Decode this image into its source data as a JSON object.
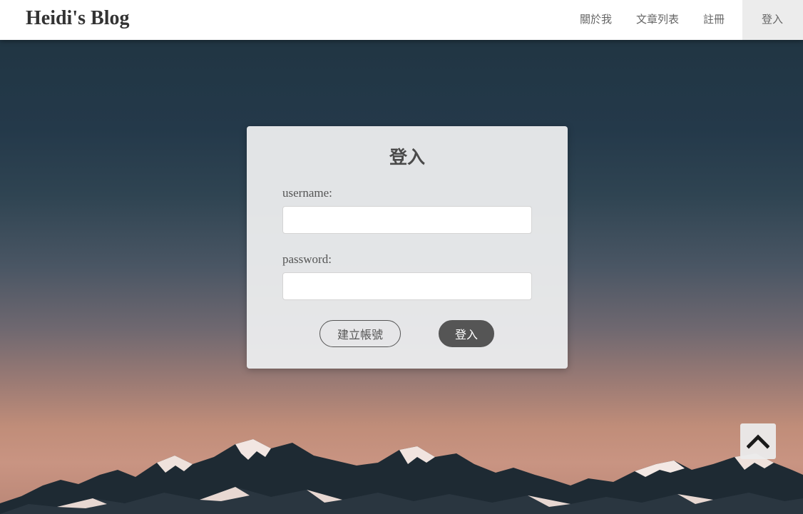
{
  "navbar": {
    "brand": "Heidi's Blog",
    "links": [
      {
        "label": "關於我"
      },
      {
        "label": "文章列表"
      },
      {
        "label": "註冊"
      },
      {
        "label": "登入",
        "active": true
      }
    ]
  },
  "login_form": {
    "title": "登入",
    "username_label": "username:",
    "username_value": "",
    "password_label": "password:",
    "password_value": "",
    "register_button": "建立帳號",
    "submit_button": "登入"
  },
  "back_to_top": {
    "icon": "chevron-up-icon"
  },
  "colors": {
    "button_dark": "#555555",
    "navbar_bg": "#ffffff",
    "active_nav_bg": "#ececec"
  }
}
